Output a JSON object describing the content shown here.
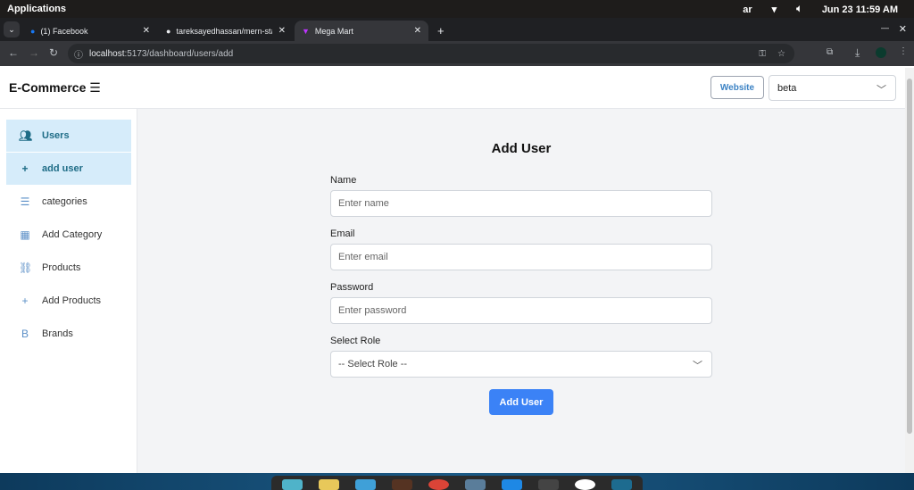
{
  "system": {
    "applications": "Applications",
    "lang": "ar",
    "datetime": "Jun 23  11:59 AM"
  },
  "browser": {
    "tabs": [
      {
        "label": "(1) Facebook"
      },
      {
        "label": "tareksayedhassan/mern-sta"
      },
      {
        "label": "Mega Mart"
      }
    ],
    "url_host": "localhost",
    "url_path": ":5173/dashboard/users/add"
  },
  "header": {
    "brand": "E-Commerce",
    "website_button": "Website",
    "select_value": "beta"
  },
  "sidebar": {
    "items": [
      {
        "label": "Users",
        "icon": "users-icon"
      },
      {
        "label": "add user",
        "icon": "plus-icon"
      },
      {
        "label": "categories",
        "icon": "list-icon"
      },
      {
        "label": "Add Category",
        "icon": "add-category-icon"
      },
      {
        "label": "Products",
        "icon": "products-icon"
      },
      {
        "label": "Add Products",
        "icon": "plus-icon"
      },
      {
        "label": "Brands",
        "icon": "brand-icon"
      }
    ]
  },
  "form": {
    "title": "Add User",
    "name_label": "Name",
    "name_placeholder": "Enter name",
    "email_label": "Email",
    "email_placeholder": "Enter email",
    "password_label": "Password",
    "password_placeholder": "Enter password",
    "role_label": "Select Role",
    "role_value": "-- Select Role --",
    "submit": "Add User"
  }
}
